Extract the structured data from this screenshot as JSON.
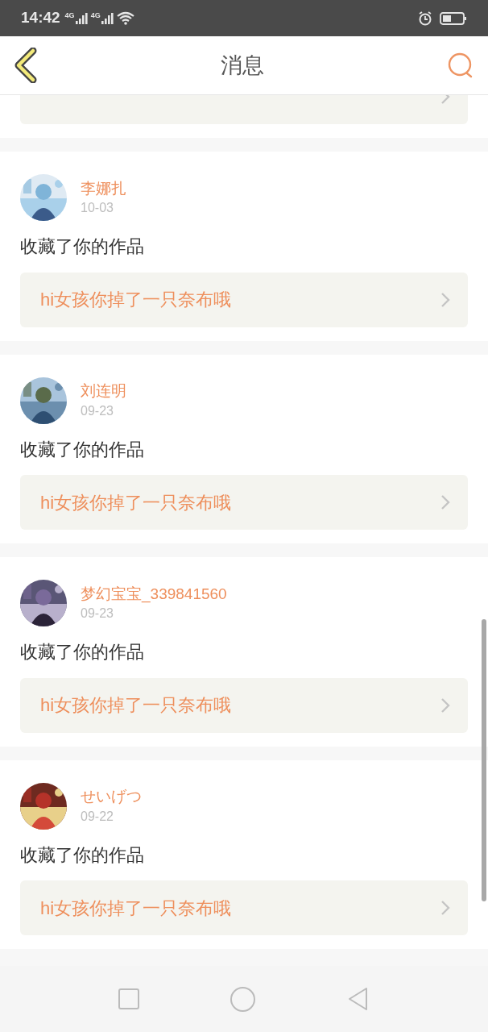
{
  "status_bar": {
    "time": "14:42",
    "networks": [
      "4G",
      "4G"
    ]
  },
  "header": {
    "title": "消息"
  },
  "messages": [
    {
      "user": "李娜扎",
      "date": "10-03",
      "action": "收藏了你的作品",
      "link": "hi女孩你掉了一只奈布哦"
    },
    {
      "user": "刘连明",
      "date": "09-23",
      "action": "收藏了你的作品",
      "link": "hi女孩你掉了一只奈布哦"
    },
    {
      "user": "梦幻宝宝_339841560",
      "date": "09-23",
      "action": "收藏了你的作品",
      "link": "hi女孩你掉了一只奈布哦"
    },
    {
      "user": "せいげつ",
      "date": "09-22",
      "action": "收藏了你的作品",
      "link": "hi女孩你掉了一只奈布哦"
    }
  ]
}
